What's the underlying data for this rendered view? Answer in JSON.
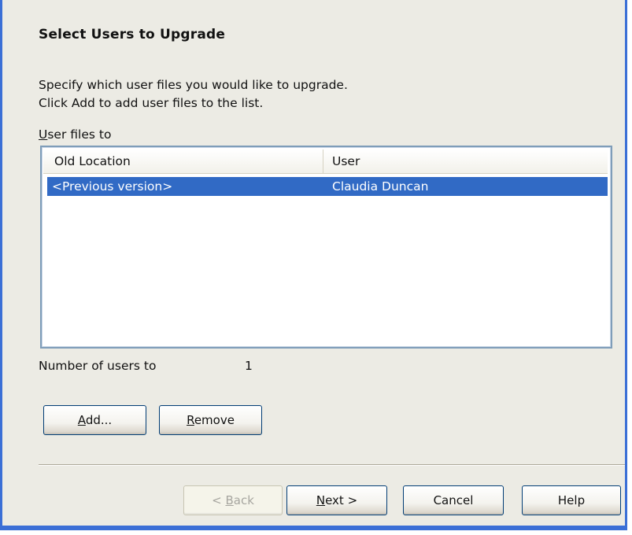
{
  "wizard": {
    "heading": "Select Users to Upgrade",
    "description_line1": "Specify which user files you would like to upgrade.",
    "description_line2": "Click Add to add user files to the list.",
    "list_label_prefix": "U",
    "list_label_rest": "ser files to",
    "columns": [
      "Old Location",
      "User"
    ],
    "rows": [
      {
        "old_location": "<Previous version>",
        "user": "Claudia Duncan",
        "selected": true
      }
    ],
    "count_label": "Number of users to",
    "count_value": "1",
    "buttons": {
      "add_mnemonic": "A",
      "add_rest": "dd...",
      "remove_mnemonic": "R",
      "remove_rest": "emove",
      "back_prefix": "< ",
      "back_mnemonic": "B",
      "back_rest": "ack",
      "next_mnemonic": "N",
      "next_rest": "ext >",
      "cancel": "Cancel",
      "help": "Help"
    }
  },
  "colors": {
    "window_border": "#3b6fd6",
    "dialog_background": "#ecebe4",
    "selection": "#316ac5",
    "button_border": "#003c74"
  }
}
